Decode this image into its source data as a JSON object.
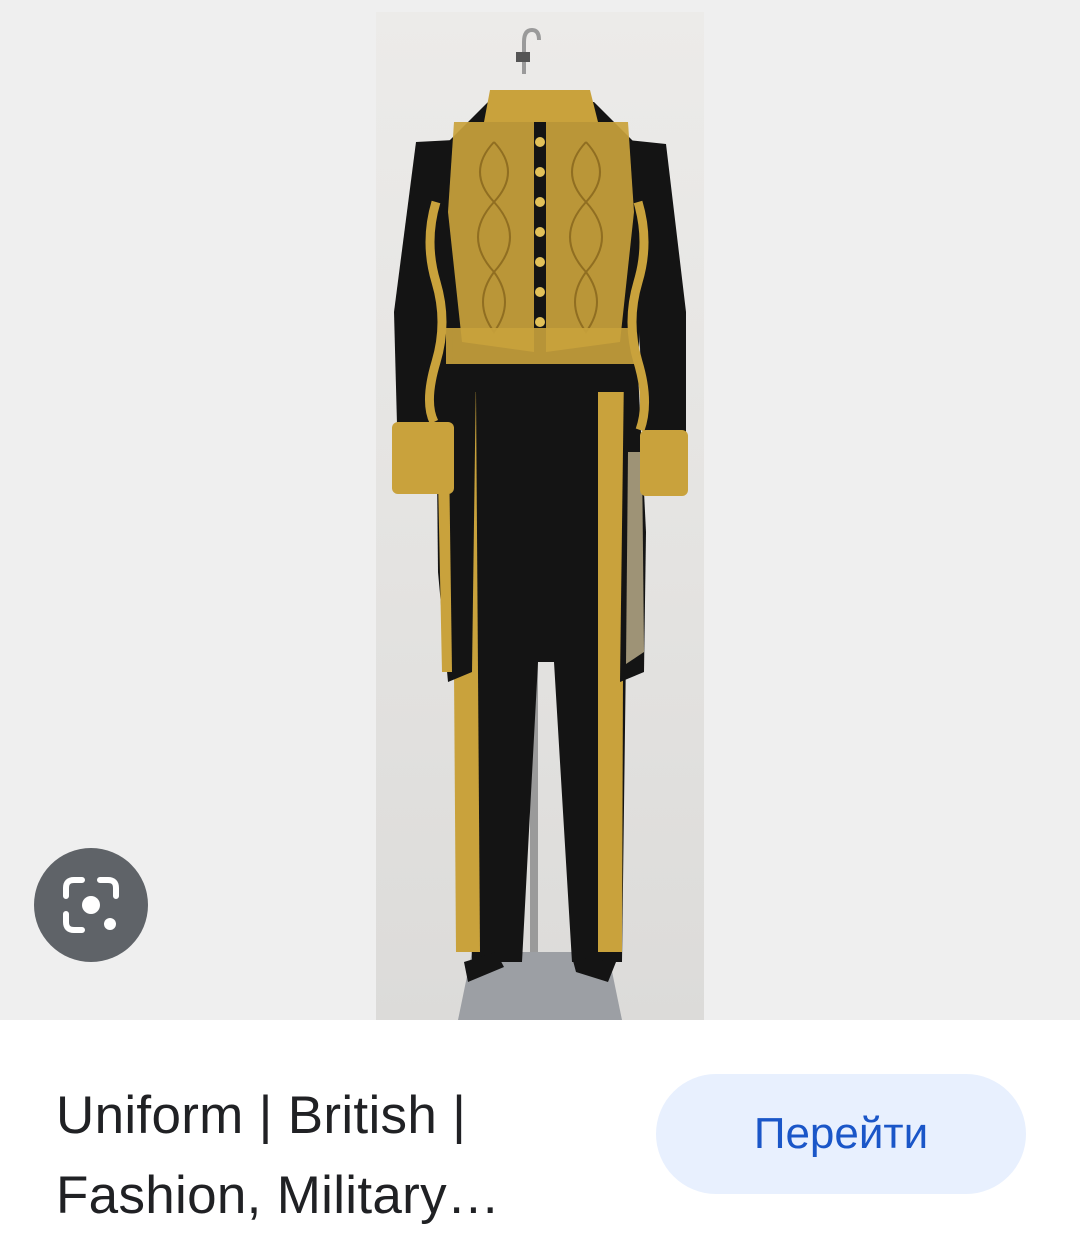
{
  "result": {
    "title": "Uniform | British | Fashion, Military…",
    "visit_label": "Перейти"
  },
  "image": {
    "subject": "Black tailcoat uniform with gold embroidery and trousers with gold stripes on a mannequin stand"
  },
  "icons": {
    "lens": "google-lens-icon"
  },
  "colors": {
    "viewer_background": "#efefef",
    "lens_button": "#5f6368",
    "visit_button_bg": "#e8f0fe",
    "visit_button_text": "#1a56c8",
    "title_text": "#202124",
    "gold": "#c9a23c",
    "fabric": "#141414"
  }
}
